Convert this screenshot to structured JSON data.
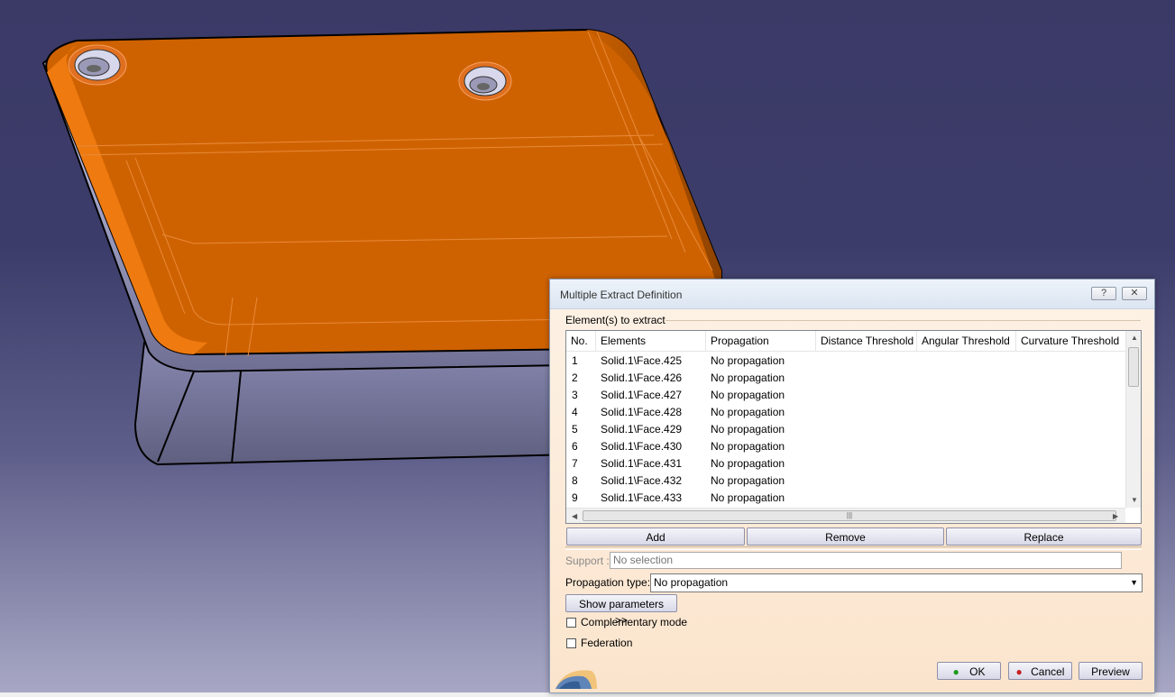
{
  "dialog": {
    "title": "Multiple Extract Definition",
    "help_label": "?",
    "close_label": "X",
    "group_label": "Element(s) to extract",
    "table": {
      "columns": [
        "No.",
        "Elements",
        "Propagation",
        "Distance Threshold",
        "Angular Threshold",
        "Curvature Threshold"
      ],
      "rows": [
        {
          "no": "1",
          "element": "Solid.1\\Face.425",
          "propagation": "No propagation"
        },
        {
          "no": "2",
          "element": "Solid.1\\Face.426",
          "propagation": "No propagation"
        },
        {
          "no": "3",
          "element": "Solid.1\\Face.427",
          "propagation": "No propagation"
        },
        {
          "no": "4",
          "element": "Solid.1\\Face.428",
          "propagation": "No propagation"
        },
        {
          "no": "5",
          "element": "Solid.1\\Face.429",
          "propagation": "No propagation"
        },
        {
          "no": "6",
          "element": "Solid.1\\Face.430",
          "propagation": "No propagation"
        },
        {
          "no": "7",
          "element": "Solid.1\\Face.431",
          "propagation": "No propagation"
        },
        {
          "no": "8",
          "element": "Solid.1\\Face.432",
          "propagation": "No propagation"
        },
        {
          "no": "9",
          "element": "Solid.1\\Face.433",
          "propagation": "No propagation"
        }
      ]
    },
    "buttons": {
      "add": "Add",
      "remove": "Remove",
      "replace": "Replace"
    },
    "support": {
      "label": "Support :",
      "value": "No selection"
    },
    "propagation_type": {
      "label": "Propagation type:",
      "value": "No propagation"
    },
    "show_parameters": "Show parameters >>",
    "complementary_mode": {
      "label": "Complementary mode",
      "checked": false
    },
    "federation": {
      "label": "Federation",
      "checked": false
    },
    "ok": "OK",
    "cancel": "Cancel",
    "preview": "Preview"
  },
  "colors": {
    "part_face": "#cf6200",
    "part_face_dark": "#a64e00",
    "part_side": "#7e7eaa",
    "background_top": "#3b3a67",
    "dialog_bg": "#fbe4cc"
  }
}
